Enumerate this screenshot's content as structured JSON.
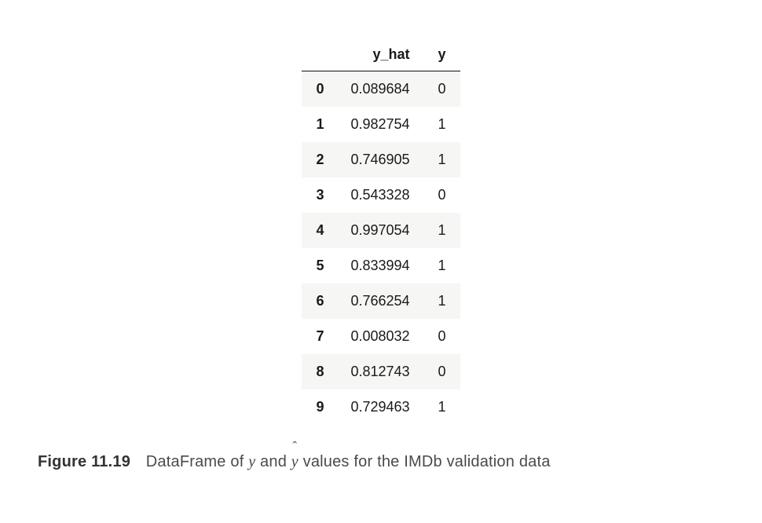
{
  "table": {
    "headers": {
      "index": "",
      "yhat": "y_hat",
      "y": "y"
    },
    "rows": [
      {
        "idx": "0",
        "yhat": "0.089684",
        "y": "0"
      },
      {
        "idx": "1",
        "yhat": "0.982754",
        "y": "1"
      },
      {
        "idx": "2",
        "yhat": "0.746905",
        "y": "1"
      },
      {
        "idx": "3",
        "yhat": "0.543328",
        "y": "0"
      },
      {
        "idx": "4",
        "yhat": "0.997054",
        "y": "1"
      },
      {
        "idx": "5",
        "yhat": "0.833994",
        "y": "1"
      },
      {
        "idx": "6",
        "yhat": "0.766254",
        "y": "1"
      },
      {
        "idx": "7",
        "yhat": "0.008032",
        "y": "0"
      },
      {
        "idx": "8",
        "yhat": "0.812743",
        "y": "0"
      },
      {
        "idx": "9",
        "yhat": "0.729463",
        "y": "1"
      }
    ]
  },
  "caption": {
    "label": "Figure 11.19",
    "pre": "DataFrame of ",
    "y": "y",
    "and": " and ",
    "yhat_base": "y",
    "post": " values for the IMDb validation data"
  }
}
